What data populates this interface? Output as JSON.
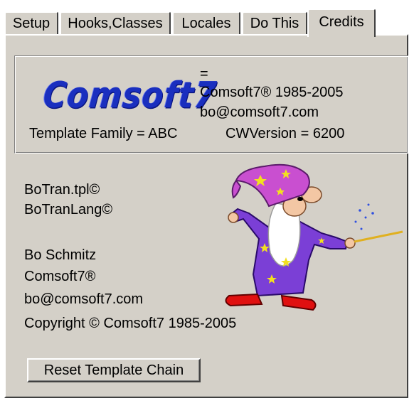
{
  "tabs": [
    {
      "label": "Setup"
    },
    {
      "label": "Hooks,Classes"
    },
    {
      "label": "Locales"
    },
    {
      "label": "Do This"
    },
    {
      "label": "Credits"
    }
  ],
  "active_tab": "Credits",
  "header": {
    "logo_text": "Comsoft7",
    "equals": "=",
    "copyright_line": "Comsoft7® 1985-2005",
    "email": "bo@comsoft7.com",
    "template_family": "Template Family = ABC",
    "cw_version": "CWVersion = 6200"
  },
  "files": {
    "line1": "BoTran.tpl©",
    "line2": "BoTranLang©"
  },
  "author": {
    "name": "Bo Schmitz",
    "company": "Comsoft7®",
    "email": "bo@comsoft7.com",
    "copyright": "Copyright © Comsoft7 1985-2005"
  },
  "reset_button": "Reset Template Chain",
  "colors": {
    "dialog_bg": "#d4d0c8",
    "logo_blue": "#1a2fbf",
    "wizard_robe": "#7b3fd6",
    "wizard_hat": "#c94fd0",
    "wizard_shoes": "#e01010",
    "stars": "#f2e020"
  }
}
